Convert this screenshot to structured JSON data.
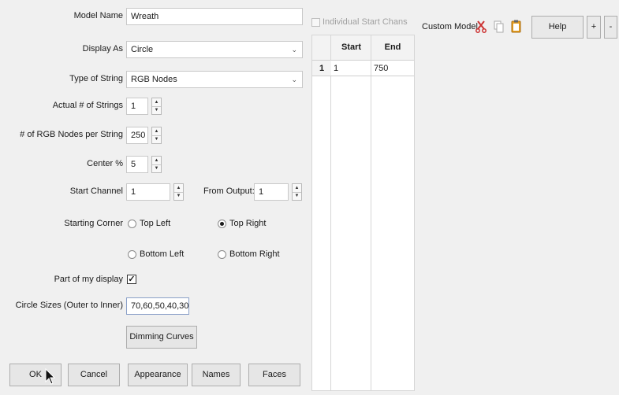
{
  "form": {
    "model_name": {
      "label": "Model Name",
      "value": "Wreath"
    },
    "display_as": {
      "label": "Display As",
      "value": "Circle"
    },
    "type_of_string": {
      "label": "Type of String",
      "value": "RGB Nodes"
    },
    "actual_strings": {
      "label": "Actual # of Strings",
      "value": "1"
    },
    "nodes_per_string": {
      "label": "# of RGB Nodes per String",
      "value": "250"
    },
    "center_pct": {
      "label": "Center %",
      "value": "5"
    },
    "start_channel": {
      "label": "Start Channel",
      "value": "1"
    },
    "from_output": {
      "label": "From Output:",
      "value": "1"
    },
    "starting_corner": {
      "label": "Starting Corner",
      "top_left": "Top Left",
      "top_right": "Top Right",
      "bottom_left": "Bottom Left",
      "bottom_right": "Bottom Right",
      "selected": "Top Right"
    },
    "part_of_display": {
      "label": "Part of my display",
      "checked": true
    },
    "circle_sizes": {
      "label": "Circle Sizes (Outer to Inner)",
      "value": "70,60,50,40,30"
    },
    "dimming_curves": "Dimming Curves"
  },
  "individual_start_chans": {
    "label": "Individual Start Chans",
    "checked": false
  },
  "channel_table": {
    "columns": [
      "Start",
      "End"
    ],
    "rows": [
      {
        "num": "1",
        "start": "1",
        "end": "750"
      }
    ]
  },
  "custom_model": {
    "label": "Custom Model",
    "help": "Help",
    "plus": "+",
    "minus": "-"
  },
  "buttons": {
    "ok": "OK",
    "cancel": "Cancel",
    "appearance": "Appearance",
    "names": "Names",
    "faces": "Faces"
  },
  "colors": {
    "scissors": "#cc3333",
    "copy_icon": "#aaaaaa",
    "paste_icon": "#e8a020"
  }
}
